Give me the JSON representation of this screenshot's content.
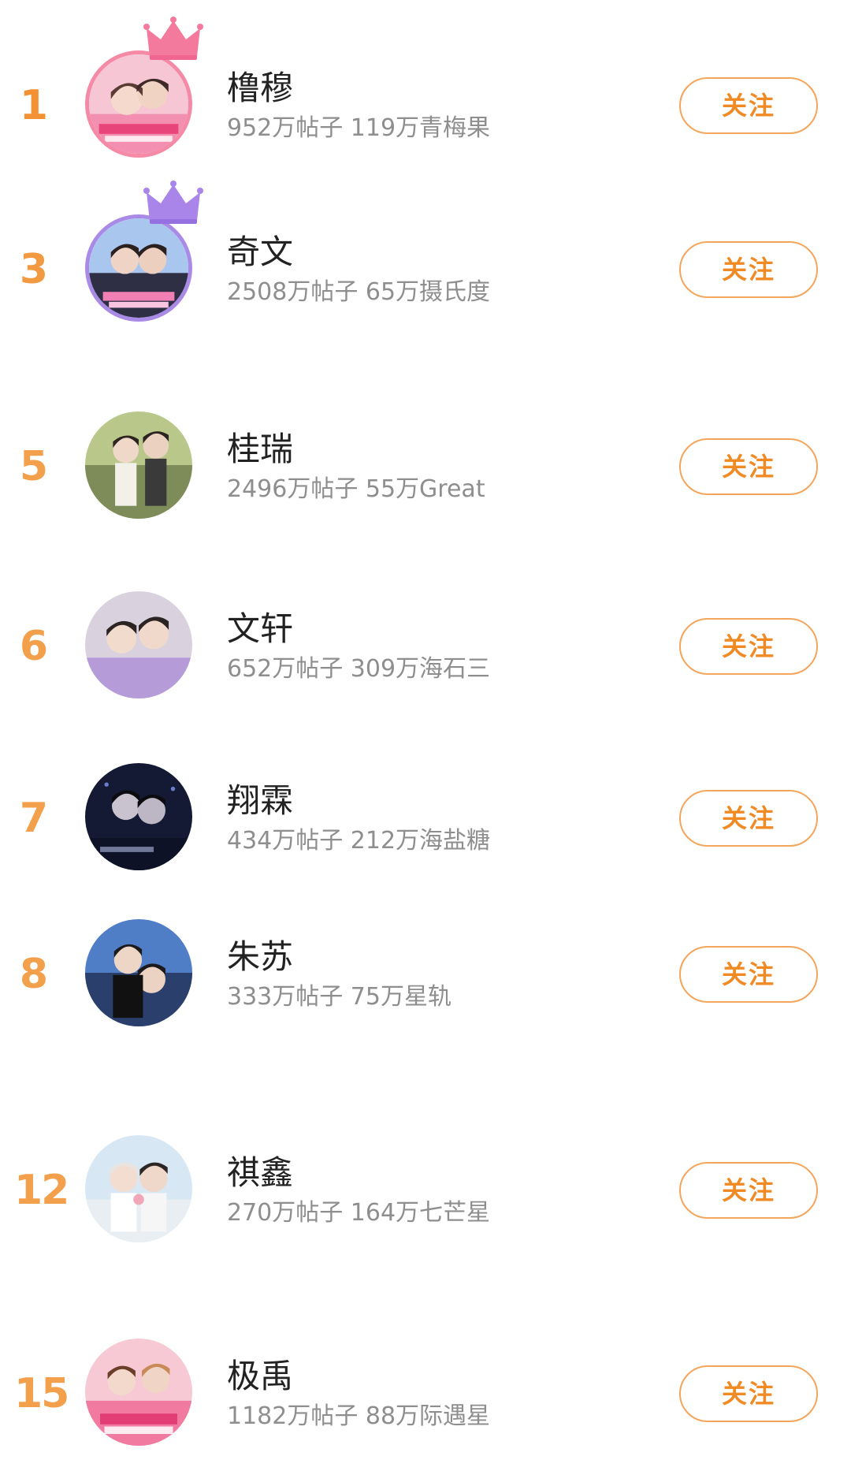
{
  "theme": {
    "accent": "#f08a24",
    "rank_color": "#f3a04c",
    "name_color": "#222222",
    "stats_color": "#8e8e8e"
  },
  "items": [
    {
      "rank": "1",
      "name": "橹穆",
      "stats": "952万帖子 119万青梅果",
      "follow_label": "关注",
      "crown": "pink-crown-icon"
    },
    {
      "rank": "3",
      "name": "奇文",
      "stats": "2508万帖子 65万摄氏度",
      "follow_label": "关注",
      "crown": "purple-crown-icon"
    },
    {
      "rank": "5",
      "name": "桂瑞",
      "stats": "2496万帖子 55万Great",
      "follow_label": "关注"
    },
    {
      "rank": "6",
      "name": "文轩",
      "stats": "652万帖子 309万海石三",
      "follow_label": "关注"
    },
    {
      "rank": "7",
      "name": "翔霖",
      "stats": "434万帖子 212万海盐糖",
      "follow_label": "关注"
    },
    {
      "rank": "8",
      "name": "朱苏",
      "stats": "333万帖子 75万星轨",
      "follow_label": "关注"
    },
    {
      "rank": "12",
      "name": "祺鑫",
      "stats": "270万帖子 164万七芒星",
      "follow_label": "关注"
    },
    {
      "rank": "15",
      "name": "极禹",
      "stats": "1182万帖子 88万际遇星",
      "follow_label": "关注"
    }
  ]
}
